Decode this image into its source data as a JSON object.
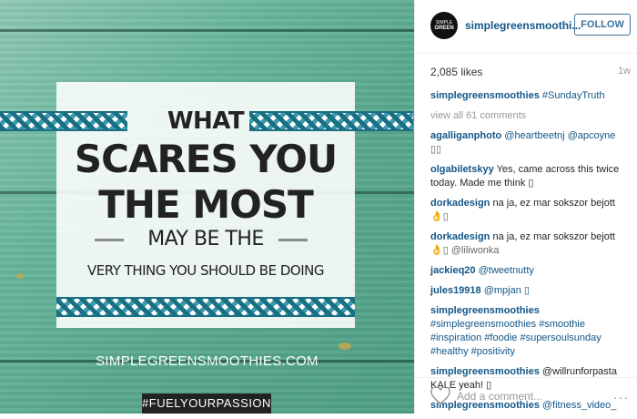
{
  "image": {
    "quote_line1": "WHAT",
    "quote_line2": "SCARES YOU",
    "quote_line3": "THE MOST",
    "quote_line4": "MAY BE THE",
    "quote_line5": "VERY THING YOU SHOULD BE DOING",
    "site_url": "SIMPLEGREENSMOOTHIES.COM",
    "hashtag": "#FUELYOURPASSION"
  },
  "header": {
    "avatar_text_top": "SIMPLE",
    "avatar_text_mid": "GREEN",
    "username": "simplegreensmoothi...",
    "follow_label": "FOLLOW"
  },
  "stats": {
    "likes": "2,085 likes",
    "age": "1w"
  },
  "caption": {
    "user": "simplegreensmoothies",
    "text": "#SundayTruth"
  },
  "view_all": "view all 61 comments",
  "comments": [
    {
      "user": "agalliganphoto",
      "text": "@heartbeetnj @apcoyne",
      "extra": "▯▯"
    },
    {
      "user": "olgabiletskyy",
      "text": "Yes, came across this twice today. Made me think ▯",
      "extra": ""
    },
    {
      "user": "dorkadesign",
      "text": "na ja, ez mar sokszor bejott",
      "extra": "👌▯"
    },
    {
      "user": "dorkadesign",
      "text": "na ja, ez mar sokszor bejott",
      "extra": "👌▯ @liliwonka"
    },
    {
      "user": "jackieq20",
      "text": "@tweetnutty",
      "extra": ""
    },
    {
      "user": "jules19918",
      "text": "@mpjan ▯",
      "extra": ""
    },
    {
      "user": "simplegreensmoothies",
      "text": "#simplegreensmoothies #smoothie #inspiration #foodie #supersoulsunday #healthy #positivity",
      "extra": ""
    },
    {
      "user": "simplegreensmoothies",
      "text": "@willrunforpasta KALE yeah! ▯",
      "extra": ""
    },
    {
      "user": "simplegreensmoothies",
      "text": "@fitness_video_",
      "extra": ""
    }
  ],
  "footer": {
    "comment_placeholder": "Add a comment...",
    "more_label": "···"
  }
}
